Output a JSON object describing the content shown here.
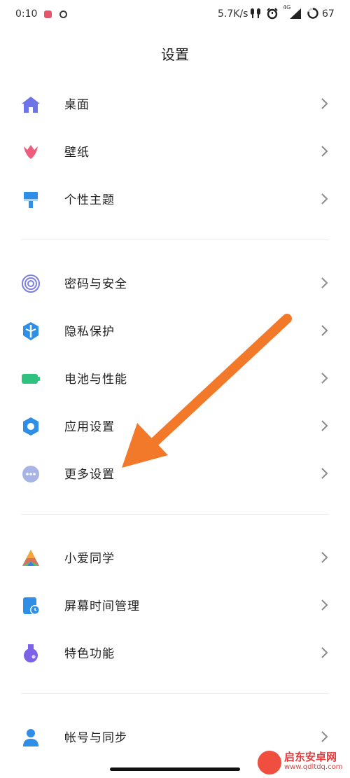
{
  "status_bar": {
    "time": "0:10",
    "net_speed": "5.7K/s",
    "network_type": "4G",
    "battery": "67",
    "icons": [
      "notification-red-icon",
      "circle-notification-icon",
      "earbuds-icon",
      "alarm-icon",
      "signal-icon",
      "battery-ring-icon"
    ]
  },
  "title": "设置",
  "groups": [
    {
      "items": [
        {
          "label": "桌面",
          "icon": "home-icon",
          "color": "#6d74e8"
        },
        {
          "label": "壁纸",
          "icon": "tulip-icon",
          "color": "#ef5d7e"
        },
        {
          "label": "个性主题",
          "icon": "paint-brush-icon",
          "color": "#2f8ee6"
        }
      ]
    },
    {
      "items": [
        {
          "label": "密码与安全",
          "icon": "fingerprint-icon",
          "color": "#7b7fe6"
        },
        {
          "label": "隐私保护",
          "icon": "privacy-shield-icon",
          "color": "#2f8ee6"
        },
        {
          "label": "电池与性能",
          "icon": "battery-icon",
          "color": "#2ec27e"
        },
        {
          "label": "应用设置",
          "icon": "gear-icon",
          "color": "#2f8ee6"
        },
        {
          "label": "更多设置",
          "icon": "more-dots-icon",
          "color": "#a8b4e3"
        }
      ]
    },
    {
      "items": [
        {
          "label": "小爱同学",
          "icon": "xiaoai-icon",
          "color": "#f0645a"
        },
        {
          "label": "屏幕时间管理",
          "icon": "screen-time-icon",
          "color": "#2f8ee6"
        },
        {
          "label": "特色功能",
          "icon": "flask-icon",
          "color": "#7b62e6"
        }
      ]
    },
    {
      "items": [
        {
          "label": "帐号与同步",
          "icon": "user-icon",
          "color": "#2f8ee6"
        }
      ]
    }
  ],
  "annotation": {
    "color": "#f2782a"
  },
  "watermark": {
    "name": "启东安卓网",
    "url": "www.qdltdq.com",
    "color": "#e63a3a"
  }
}
